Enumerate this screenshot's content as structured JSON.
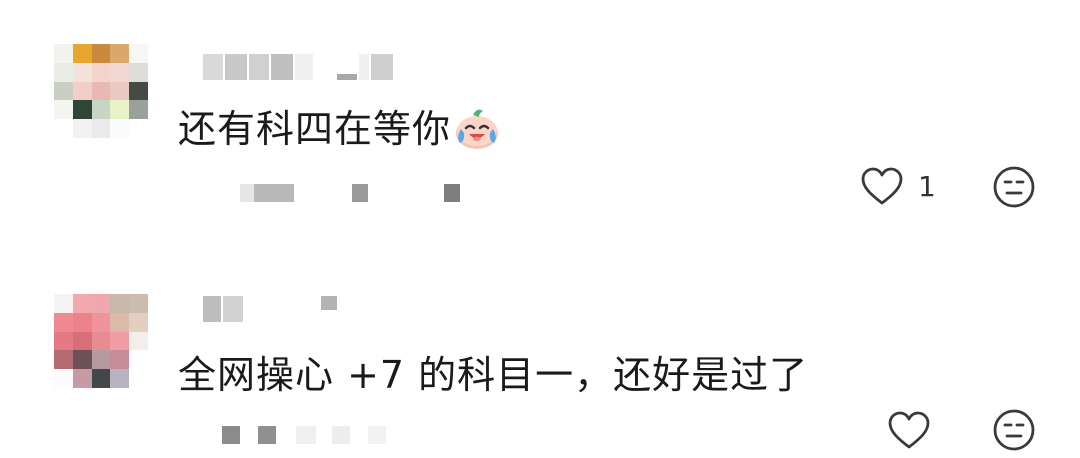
{
  "comments": [
    {
      "text": "还有科四在等你",
      "emoji": "crying-laughing-emoji",
      "like_count": "1",
      "reaction_icon": "neutral-face-icon"
    },
    {
      "text": "全网操心 +7 的科目一，还好是过了",
      "like_count": "",
      "reaction_icon": "neutral-face-icon"
    }
  ],
  "colors": {
    "text": "#1a1a1a",
    "icon": "#3a3a3a"
  }
}
